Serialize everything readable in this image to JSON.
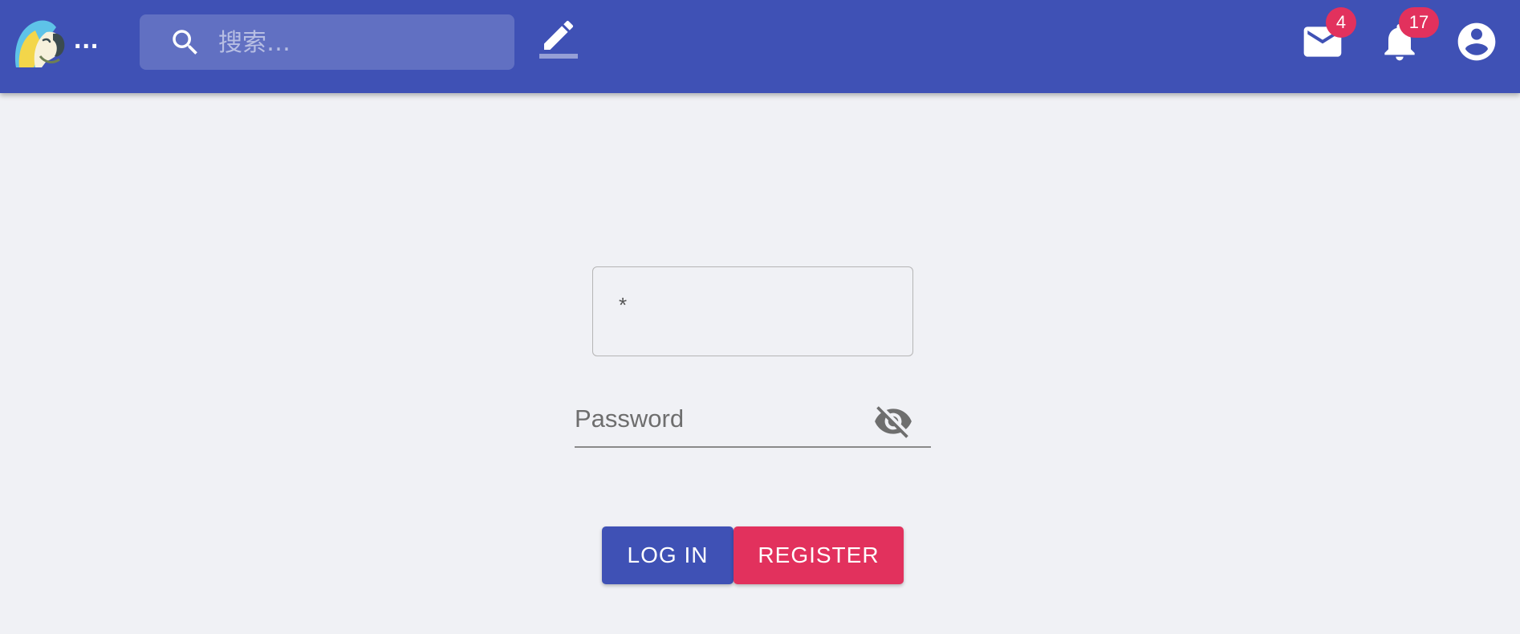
{
  "colors": {
    "primary": "#3f51b5",
    "secondary": "#e2315d",
    "background": "#f0f1f5"
  },
  "header": {
    "logo_icon": "parrot-logo-icon",
    "logo_text": "...",
    "search": {
      "icon": "search-icon",
      "placeholder": "搜索…"
    },
    "edit_icon": "pencil-icon",
    "mail": {
      "icon": "mail-icon",
      "badge": "4"
    },
    "notifications": {
      "icon": "bell-icon",
      "badge": "17"
    },
    "account_icon": "account-circle-icon"
  },
  "form": {
    "username_label": "*",
    "password_label": "Password",
    "visibility_icon": "visibility-off-icon",
    "login_label": "LOG IN",
    "register_label": "REGISTER"
  }
}
